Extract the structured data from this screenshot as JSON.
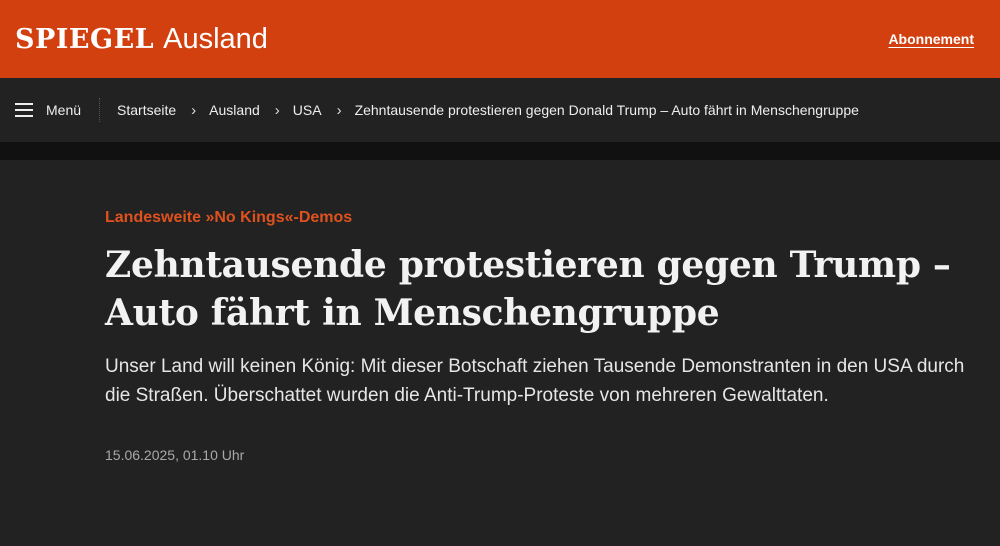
{
  "header": {
    "logo": "SPIEGEL",
    "section": "Ausland",
    "subscribe": "Abonnement"
  },
  "nav": {
    "menu_label": "Menü",
    "breadcrumbs": [
      "Startseite",
      "Ausland",
      "USA",
      "Zehntausende protestieren gegen Donald Trump – Auto fährt in Menschengruppe"
    ]
  },
  "article": {
    "kicker": "Landesweite »No Kings«-Demos",
    "headline": "Zehntausende protestieren gegen Trump – Auto fährt in Menschengruppe",
    "teaser": "Unser Land will keinen König: Mit dieser Botschaft ziehen Tausende Demonstranten in den USA durch die Straßen. Überschattet wurden die Anti-Trump-Proteste von mehreren Gewalttaten.",
    "date": "15.06.2025, 01.10 Uhr"
  },
  "colors": {
    "brand": "#d3400f",
    "kicker": "#e0521d",
    "background": "#222222"
  }
}
